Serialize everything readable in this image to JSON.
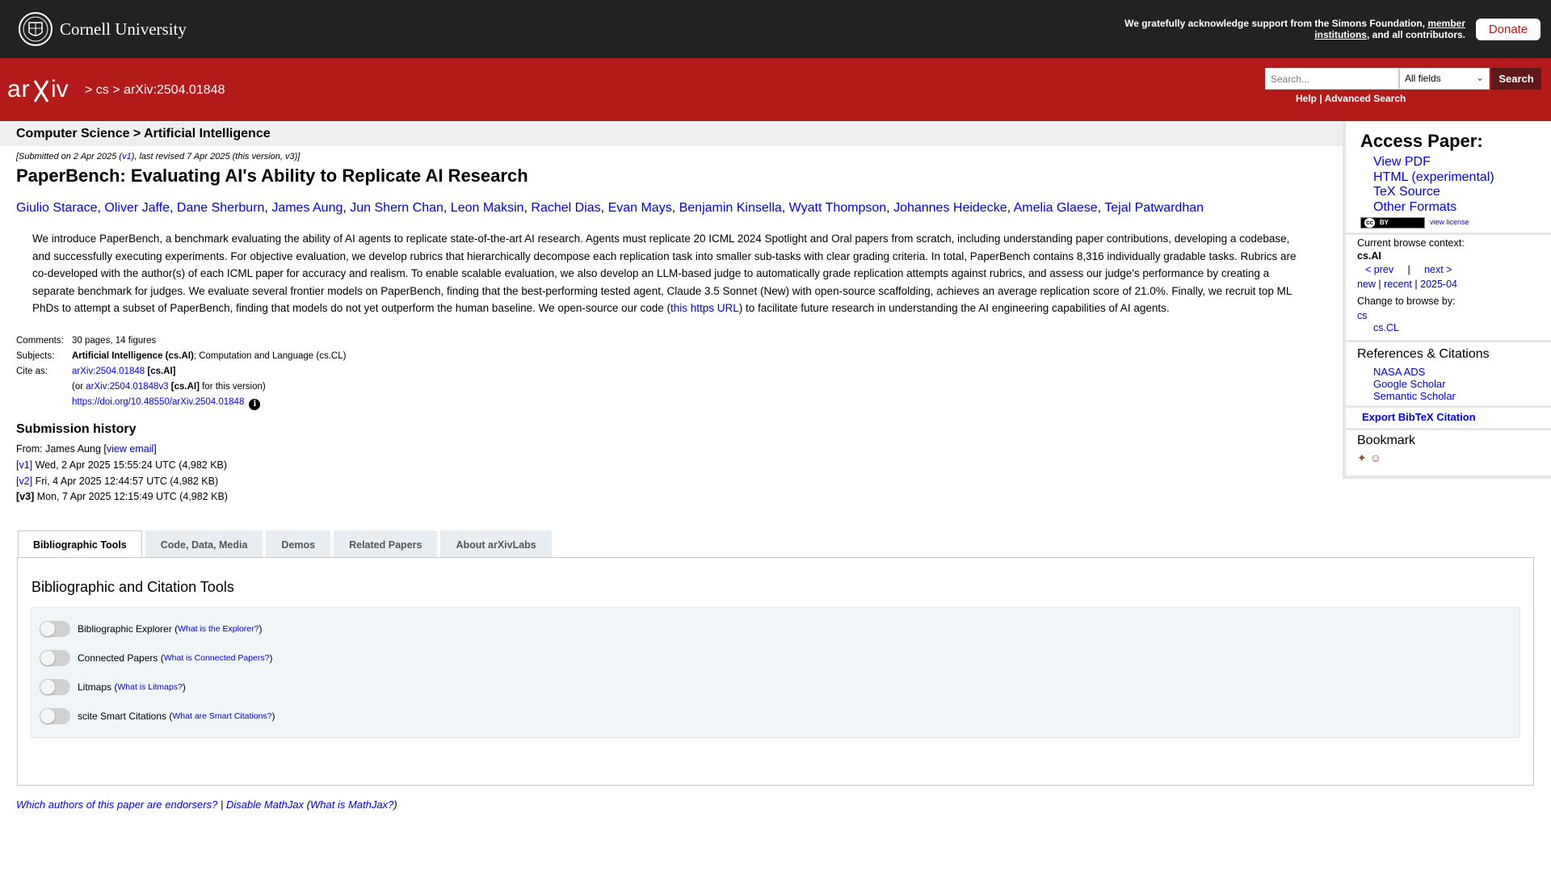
{
  "cornell": {
    "name": "Cornell University",
    "support_prefix": "We gratefully acknowledge support from the Simons Foundation, ",
    "support_link": "member institutions",
    "support_suffix": ", and all contributors.",
    "donate_label": "Donate"
  },
  "arxiv_header": {
    "logo_text": "arXiv",
    "breadcrumb": [
      {
        "sep": ">",
        "label": "cs"
      },
      {
        "sep": ">",
        "label": "arXiv:2504.01848"
      }
    ],
    "search_placeholder": "Search...",
    "field_select": "All fields",
    "search_button": "Search",
    "help_label": "Help",
    "advanced_label": "Advanced Search",
    "help_sep": "|"
  },
  "category_bar": "Computer Science > Artificial Intelligence",
  "paper": {
    "submitted_prefix": "[Submitted on 2 Apr 2025 (",
    "submitted_v1": "v1",
    "submitted_suffix": "), last revised 7 Apr 2025 (this version, v3)]",
    "title": "PaperBench: Evaluating AI's Ability to Replicate AI Research",
    "authors": [
      "Giulio Starace",
      "Oliver Jaffe",
      "Dane Sherburn",
      "James Aung",
      "Jun Shern Chan",
      "Leon Maksin",
      "Rachel Dias",
      "Evan Mays",
      "Benjamin Kinsella",
      "Wyatt Thompson",
      "Johannes Heidecke",
      "Amelia Glaese",
      "Tejal Patwardhan"
    ],
    "abstract_pre": "We introduce PaperBench, a benchmark evaluating the ability of AI agents to replicate state-of-the-art AI research. Agents must replicate 20 ICML 2024 Spotlight and Oral papers from scratch, including understanding paper contributions, developing a codebase, and successfully executing experiments. For objective evaluation, we develop rubrics that hierarchically decompose each replication task into smaller sub-tasks with clear grading criteria. In total, PaperBench contains 8,316 individually gradable tasks. Rubrics are co-developed with the author(s) of each ICML paper for accuracy and realism. To enable scalable evaluation, we also develop an LLM-based judge to automatically grade replication attempts against rubrics, and assess our judge's performance by creating a separate benchmark for judges. We evaluate several frontier models on PaperBench, finding that the best-performing tested agent, Claude 3.5 Sonnet (New) with open-source scaffolding, achieves an average replication score of 21.0%. Finally, we recruit top ML PhDs to attempt a subset of PaperBench, finding that models do not yet outperform the human baseline. We open-source our code (",
    "abstract_link": "this https URL",
    "abstract_post": ") to facilitate future research in understanding the AI engineering capabilities of AI agents.",
    "meta": {
      "comments_label": "Comments:",
      "comments": "30 pages, 14 figures",
      "subjects_label": "Subjects:",
      "subjects_primary": "Artificial Intelligence (cs.AI)",
      "subjects_rest": "; Computation and Language (cs.CL)",
      "cite_label": "Cite as:",
      "cite_id": "arXiv:2504.01848",
      "cite_cat": "[cs.AI]",
      "cite_or_prefix": "(or ",
      "cite_version": "arXiv:2504.01848v3",
      "cite_version_cat": "[cs.AI]",
      "cite_version_suffix": " for this version)",
      "doi": "https://doi.org/10.48550/arXiv.2504.01848",
      "info_icon": "i"
    },
    "history": {
      "heading": "Submission history",
      "from_prefix": "From: James Aung [",
      "view_email": "view email",
      "from_suffix": "]",
      "versions": [
        {
          "tag": "[v1]",
          "linked": true,
          "text": " Wed, 2 Apr 2025 15:55:24 UTC (4,982 KB)"
        },
        {
          "tag": "[v2]",
          "linked": true,
          "text": " Fri, 4 Apr 2025 12:44:57 UTC (4,982 KB)"
        },
        {
          "tag": "[v3]",
          "linked": false,
          "text": " Mon, 7 Apr 2025 12:15:49 UTC (4,982 KB)"
        }
      ]
    }
  },
  "tabs": [
    "Bibliographic Tools",
    "Code, Data, Media",
    "Demos",
    "Related Papers",
    "About arXivLabs"
  ],
  "panel": {
    "heading": "Bibliographic and Citation Tools",
    "toggles": [
      {
        "label": "Bibliographic Explorer",
        "help": "What is the Explorer?"
      },
      {
        "label": "Connected Papers",
        "help": "What is Connected Papers?"
      },
      {
        "label": "Litmaps",
        "help": "What is Litmaps?"
      },
      {
        "label": "scite Smart Citations",
        "help": "What are Smart Citations?"
      }
    ]
  },
  "footer": {
    "endorsers": "Which authors of this paper are endorsers?",
    "sep": "|",
    "disable_mathjax": "Disable MathJax",
    "what_mathjax": "What is MathJax?"
  },
  "sidebar": {
    "access_heading": "Access Paper:",
    "access_links": [
      "View PDF",
      "HTML (experimental)",
      "TeX Source",
      "Other Formats"
    ],
    "license_badge": "cc BY",
    "view_license": "view license",
    "context_label": "Current browse context:",
    "context_value": "cs.AI",
    "prev": "< prev",
    "nav_sep": "|",
    "next": "next >",
    "new": "new",
    "recent": "recent",
    "month": "2025-04",
    "change_label": "Change to browse by:",
    "change_cs": "cs",
    "change_cl": "cs.CL",
    "refs_heading": "References & Citations",
    "refs": [
      "NASA ADS",
      "Google Scholar",
      "Semantic Scholar"
    ],
    "bibtex": "Export BibTeX Citation",
    "bookmark_heading": "Bookmark",
    "bookmark_icons": [
      "bibsonomy-icon",
      "reddit-icon"
    ]
  },
  "colors": {
    "cornell_bar": "#222222",
    "arxiv_red": "#b31b1b",
    "search_button": "#5f1919",
    "link": "#0000ee",
    "toggle_panel": "#f0f5f8"
  }
}
